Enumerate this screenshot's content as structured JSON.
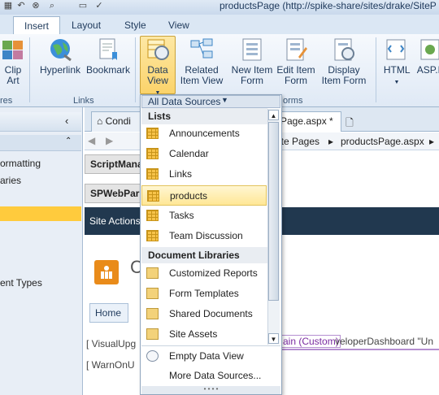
{
  "window": {
    "title": "productsPage (http://spike-share/sites/drake/SiteP"
  },
  "ribbon": {
    "tabs": [
      "Insert",
      "Layout",
      "Style",
      "View"
    ],
    "active_tab": "Insert",
    "buttons": {
      "clip_art": "Clip Art",
      "hyperlink": "Hyperlink",
      "bookmark": "Bookmark",
      "data_view": "Data View",
      "related_item_view": "Related Item View",
      "new_item_form": "New Item Form",
      "edit_item_form": "Edit Item Form",
      "display_item_form": "Display Item Form",
      "html": "HTML",
      "asp": "ASP.N"
    },
    "groups": {
      "partial_left": "res",
      "links": "Links",
      "forms": "orms"
    }
  },
  "left_panel": {
    "items": [
      "ormatting",
      "aries",
      "ent Types"
    ]
  },
  "doc": {
    "tabs": [
      "Condi",
      "Page.aspx *"
    ],
    "breadcrumb": [
      "ite Pages",
      "productsPage.aspx"
    ],
    "controls": [
      "ScriptMana",
      "SPWebPar"
    ],
    "site_actions": "Site Actions",
    "site_initial": "C",
    "home": "Home",
    "code_lines": [
      "[ VisualUpg",
      "[ WarnOnU"
    ],
    "custom_tag": "ain (Custom)",
    "code_tail": "veloperDashboard \"Un"
  },
  "dropdown": {
    "header": "All Data Sources",
    "sections": {
      "lists": "Lists",
      "document_libraries": "Document Libraries"
    },
    "lists": [
      "Announcements",
      "Calendar",
      "Links",
      "products",
      "Tasks",
      "Team Discussion"
    ],
    "highlighted": "products",
    "libraries": [
      "Customized Reports",
      "Form Templates",
      "Shared Documents",
      "Site Assets"
    ],
    "footer": [
      "Empty Data View",
      "More Data Sources..."
    ]
  }
}
